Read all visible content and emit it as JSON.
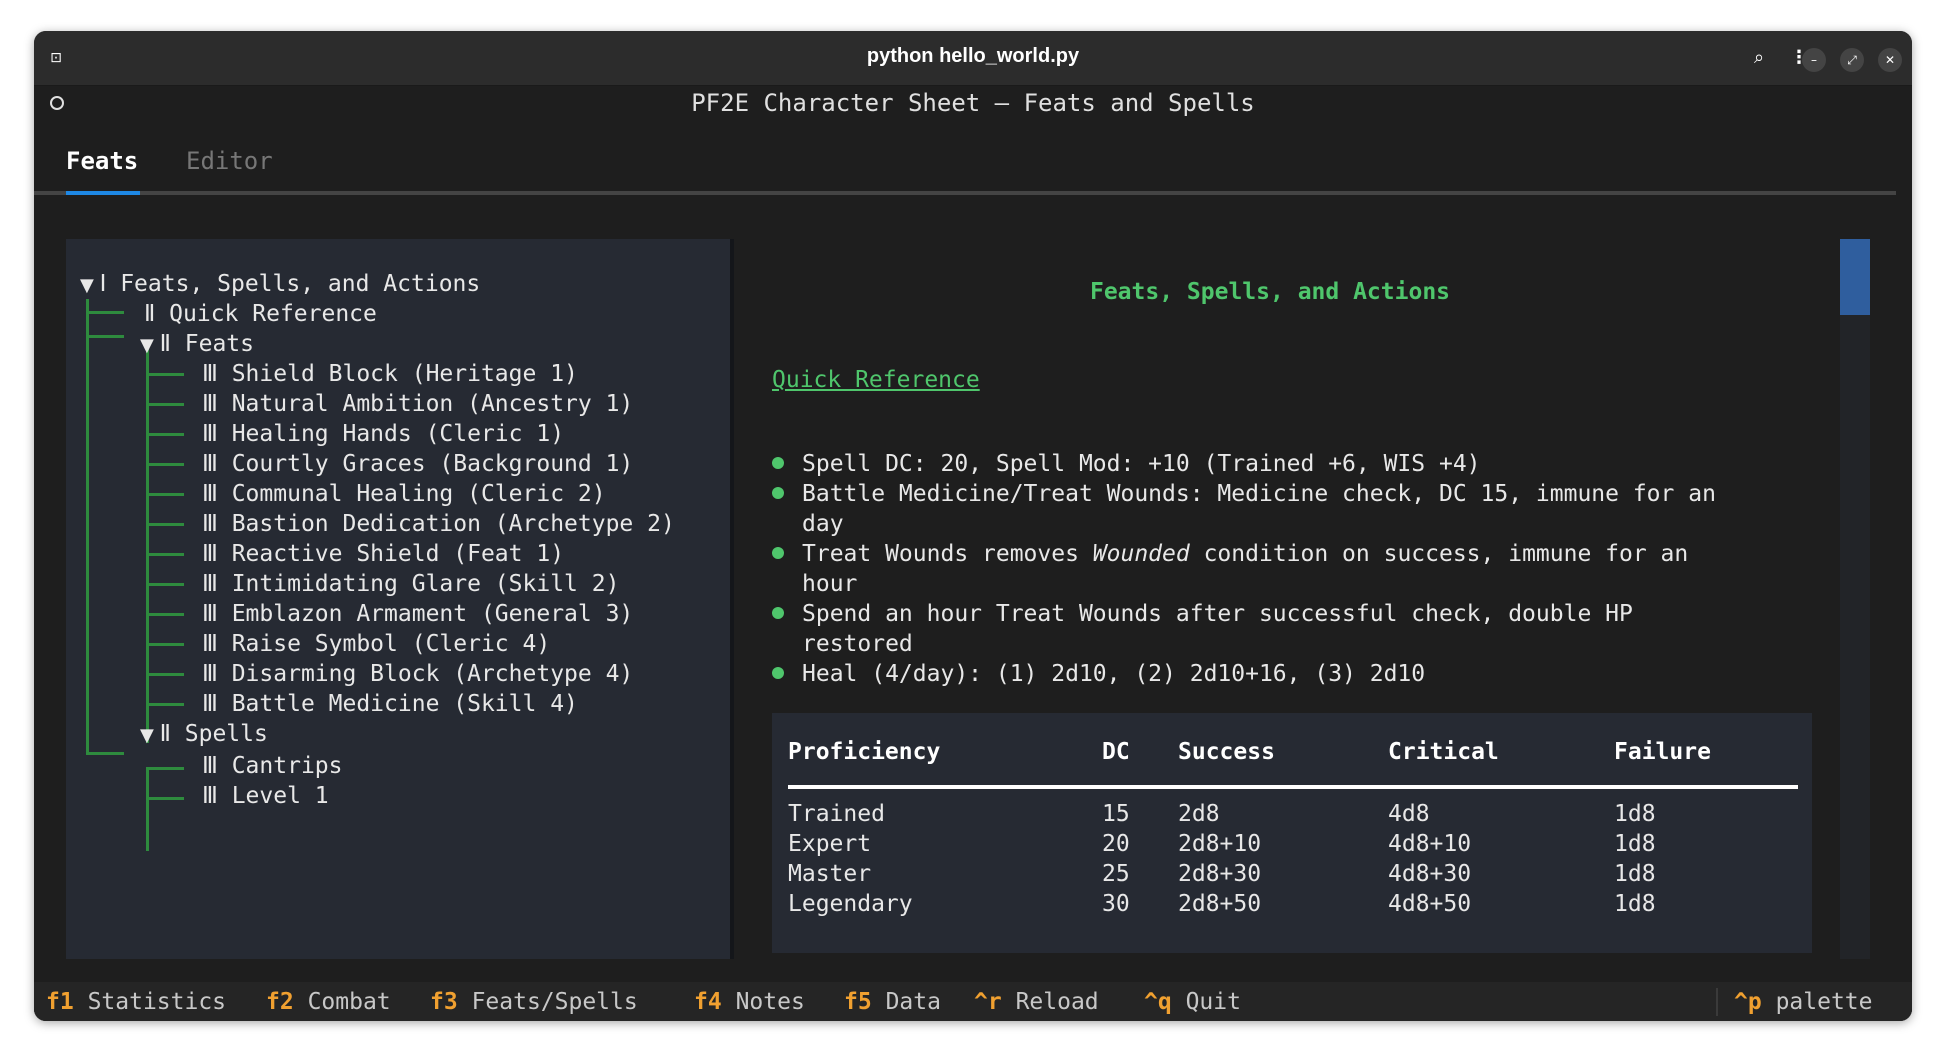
{
  "window": {
    "title": "python hello_world.py"
  },
  "titlebar_icons": {
    "pin": "pin-icon",
    "search": "search-icon",
    "menu": "kebab-menu-icon",
    "min": "minimize-icon",
    "max": "maximize-icon",
    "close": "close-icon"
  },
  "app": {
    "header_title": "PF2E Character Sheet — Feats and Spells"
  },
  "tabs": [
    {
      "label": "Feats",
      "active": true
    },
    {
      "label": "Editor",
      "active": false
    }
  ],
  "tree": {
    "root": "Ⅰ Feats, Spells, and Actions",
    "quick_reference": "Ⅱ Quick Reference",
    "feats": "Ⅱ Feats",
    "feat_items": [
      "Ⅲ Shield Block (Heritage 1)",
      "Ⅲ Natural Ambition (Ancestry 1)",
      "Ⅲ Healing Hands (Cleric 1)",
      "Ⅲ Courtly Graces (Background 1)",
      "Ⅲ Communal Healing (Cleric 2)",
      "Ⅲ Bastion Dedication (Archetype 2)",
      "Ⅲ Reactive Shield (Feat 1)",
      "Ⅲ Intimidating Glare (Skill 2)",
      "Ⅲ Emblazon Armament (General 3)",
      "Ⅲ Raise Symbol (Cleric 4)",
      "Ⅲ Disarming Block (Archetype 4)",
      "Ⅲ Battle Medicine (Skill 4)"
    ],
    "spells": "Ⅱ Spells",
    "spell_items": [
      "Ⅲ Cantrips",
      "Ⅲ Level 1"
    ]
  },
  "content": {
    "title": "Feats, Spells, and Actions",
    "link": "Quick Reference",
    "bullets": [
      {
        "line1": "Spell DC: 20, Spell Mod: +10 (Trained +6, WIS +4)",
        "line2": ""
      },
      {
        "line1": "Battle Medicine/Treat Wounds: Medicine check, DC 15, immune for an",
        "line2": "day"
      },
      {
        "line1_a": "Treat Wounds removes ",
        "line1_em": "Wounded",
        "line1_b": " condition on success, immune for an",
        "line2": "hour"
      },
      {
        "line1": "Spend an hour Treat Wounds after successful check, double HP",
        "line2": "restored"
      },
      {
        "line1": "Heal (4/day): (1) 2d10, (2) 2d10+16, (3) 2d10",
        "line2": ""
      }
    ],
    "table": {
      "headers": [
        "Proficiency",
        "DC",
        "Success",
        "Critical",
        "Failure"
      ],
      "rows": [
        [
          "Trained",
          "15",
          "2d8",
          "4d8",
          "1d8"
        ],
        [
          "Expert",
          "20",
          "2d8+10",
          "4d8+10",
          "1d8"
        ],
        [
          "Master",
          "25",
          "2d8+30",
          "4d8+30",
          "1d8"
        ],
        [
          "Legendary",
          "30",
          "2d8+50",
          "4d8+50",
          "1d8"
        ]
      ]
    }
  },
  "footer": [
    {
      "key": "f1",
      "label": "Statistics"
    },
    {
      "key": "f2",
      "label": "Combat"
    },
    {
      "key": "f3",
      "label": "Feats/Spells"
    },
    {
      "key": "f4",
      "label": "Notes"
    },
    {
      "key": "f5",
      "label": "Data"
    },
    {
      "key": "^r",
      "label": "Reload"
    },
    {
      "key": "^q",
      "label": "Quit"
    }
  ],
  "footer_right": {
    "key": "^p",
    "label": "palette"
  },
  "colors": {
    "accent_green": "#4fc66c",
    "tab_blue": "#1e88e5",
    "footer_key": "#f0a030",
    "tree_line": "#2e8b3e"
  }
}
